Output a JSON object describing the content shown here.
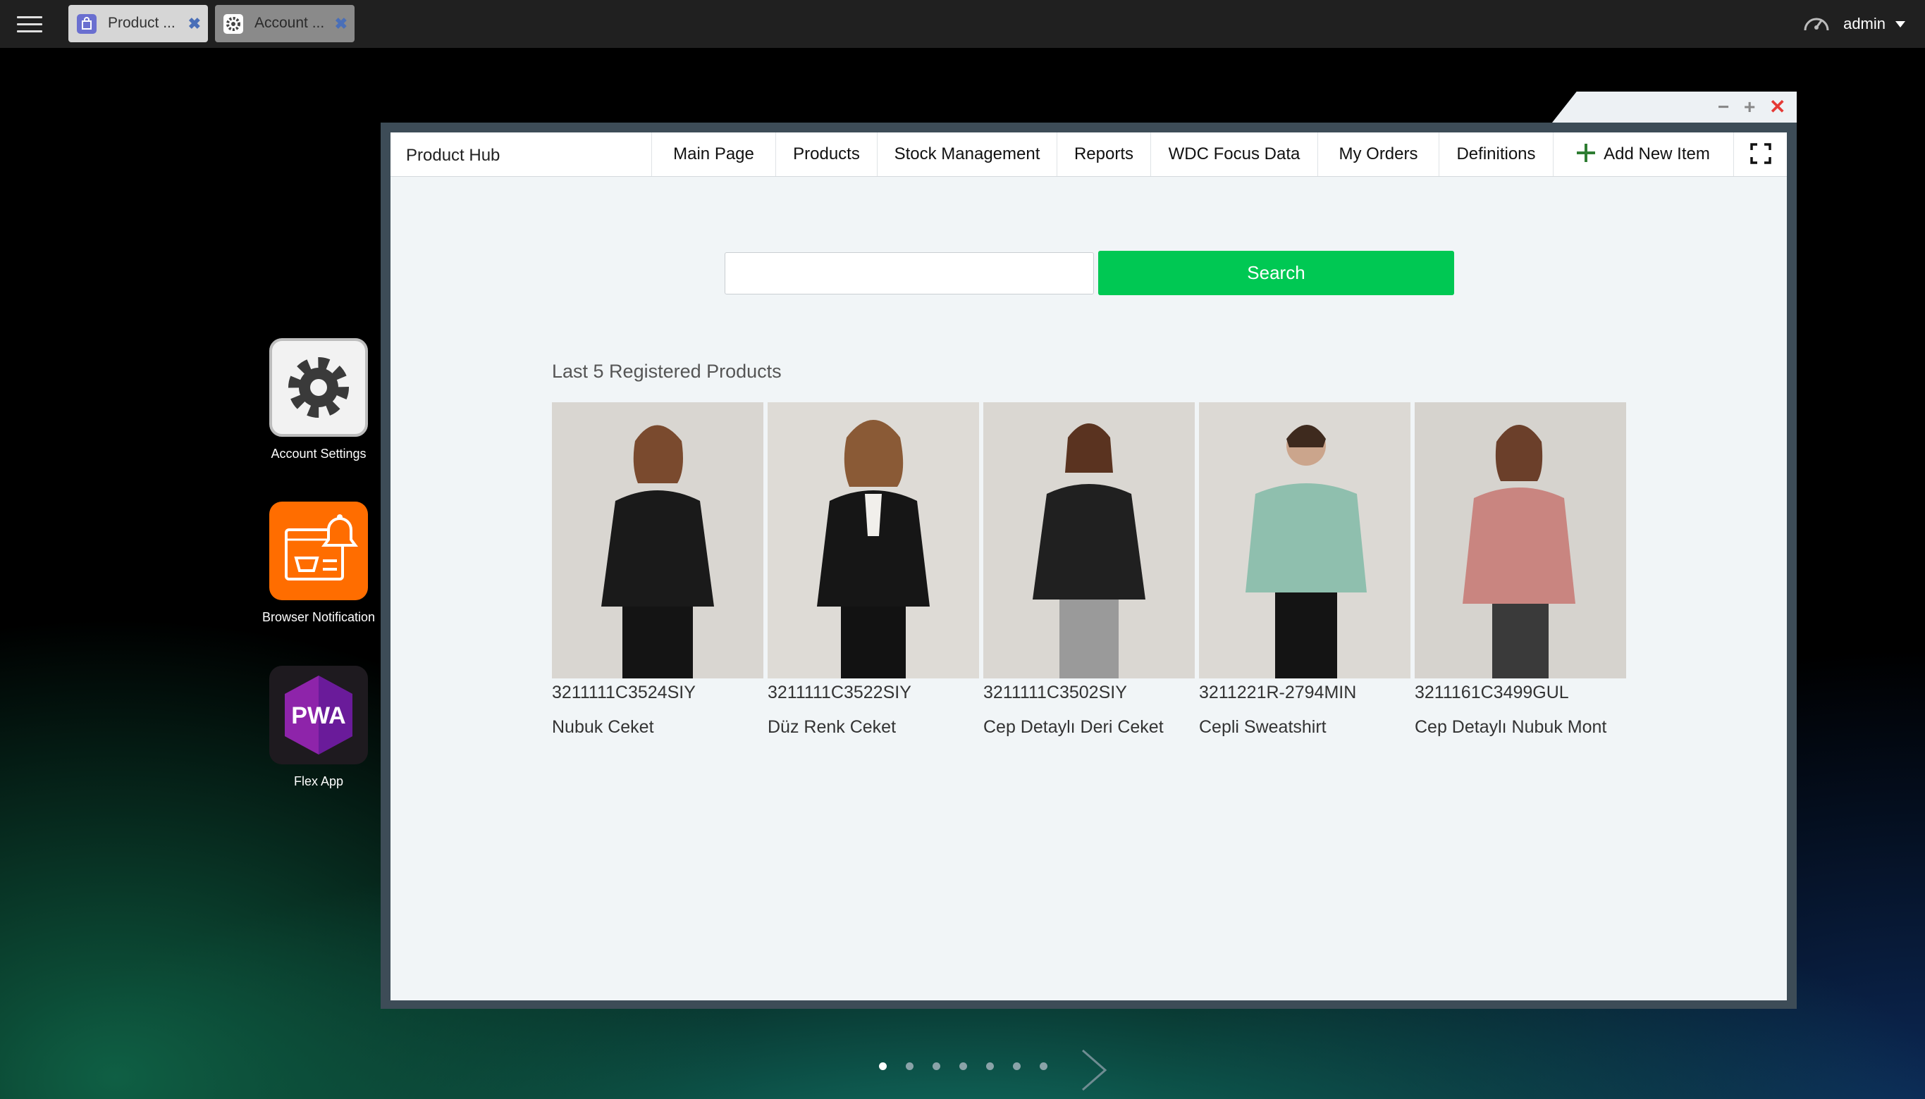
{
  "taskbar": {
    "tabs": [
      {
        "label": "Product ...",
        "icon": "shopping-bag-icon"
      },
      {
        "label": "Account ...",
        "icon": "gear-icon"
      }
    ],
    "user": "admin"
  },
  "desktop": {
    "icons": [
      {
        "label": "Account Settings",
        "icon": "gear-icon"
      },
      {
        "label": "Browser Notification",
        "icon": "notification-bell-icon"
      },
      {
        "label": "Flex App",
        "icon": "pwa-icon",
        "logo_text": "PWA"
      }
    ]
  },
  "window": {
    "brand": "Product Hub",
    "nav": [
      "Main Page",
      "Products",
      "Stock Management",
      "Reports",
      "WDC Focus Data",
      "My Orders",
      "Definitions"
    ],
    "add_new_item": "Add New Item",
    "search": {
      "value": "",
      "button": "Search"
    },
    "section_title": "Last 5 Registered Products",
    "products": [
      {
        "code": "3211111C3524SIY",
        "name": "Nubuk Ceket",
        "color": "#1a1a1a"
      },
      {
        "code": "3211111C3522SIY",
        "name": "Düz Renk Ceket",
        "color": "#161616"
      },
      {
        "code": "3211111C3502SIY",
        "name": "Cep Detaylı Deri Ceket",
        "color": "#202020"
      },
      {
        "code": "3211221R-2794MIN",
        "name": "Cepli Sweatshirt",
        "color": "#8fbfae"
      },
      {
        "code": "3211161C3499GUL",
        "name": "Cep Detaylı Nubuk Mont",
        "color": "#c98580"
      }
    ]
  },
  "pager": {
    "pages": 7,
    "active": 1
  },
  "colors": {
    "accent": "#00c853",
    "close": "#e53935",
    "topbar": "#202020"
  }
}
